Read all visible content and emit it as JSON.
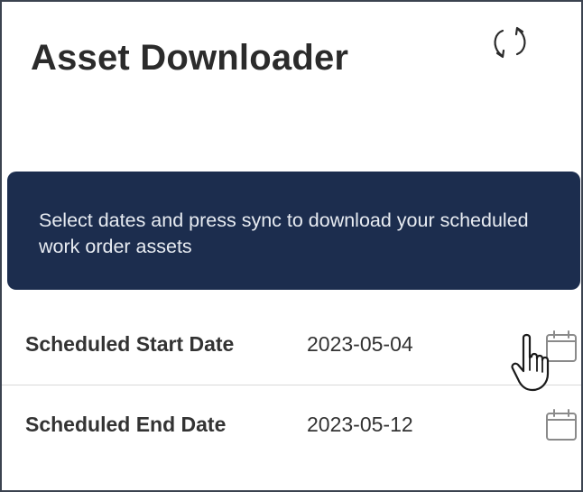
{
  "header": {
    "title": "Asset Downloader",
    "sync_icon": "sync-icon"
  },
  "banner": {
    "text": "Select dates and press sync to download your scheduled work order assets",
    "background": "#1c2d4e"
  },
  "fields": [
    {
      "label": "Scheduled Start Date",
      "value": "2023-05-04",
      "icon": "calendar-icon"
    },
    {
      "label": "Scheduled End Date",
      "value": "2023-05-12",
      "icon": "calendar-icon"
    }
  ]
}
